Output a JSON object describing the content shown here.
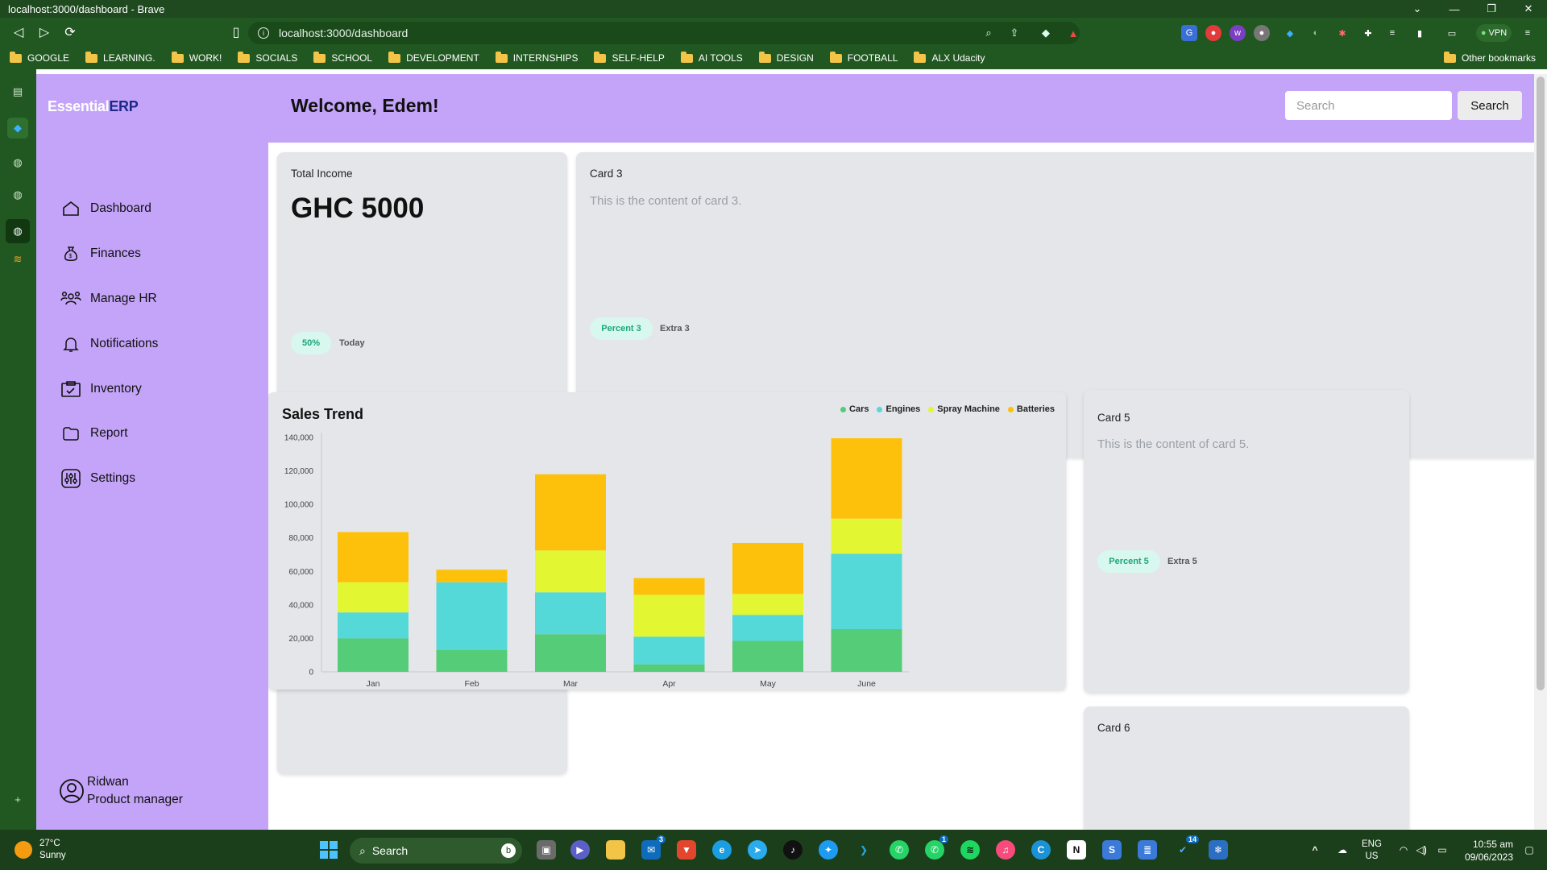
{
  "window": {
    "title": "localhost:3000/dashboard - Brave",
    "url": "localhost:3000/dashboard",
    "vpn_label": "VPN"
  },
  "bookmarks": [
    "GOOGLE",
    "LEARNING.",
    "WORK!",
    "SOCIALS",
    "SCHOOL",
    "DEVELOPMENT",
    "INTERNSHIPS",
    "SELF-HELP",
    "AI TOOLS",
    "DESIGN",
    "FOOTBALL",
    "ALX Udacity"
  ],
  "other_bookmarks": "Other bookmarks",
  "app": {
    "logo_part1": "Essential",
    "logo_part2": "ERP",
    "welcome": "Welcome, Edem!",
    "search_placeholder": "Search",
    "search_button": "Search",
    "nav": [
      "Dashboard",
      "Finances",
      "Manage HR",
      "Notifications",
      "Inventory",
      "Report",
      "Settings"
    ],
    "user": {
      "name": "Ridwan",
      "role": "Product manager"
    }
  },
  "cards": {
    "income": {
      "title": "Total Income",
      "value": "GHC 5000",
      "percent": "50%",
      "extra": "Today"
    },
    "card3": {
      "title": "Card 3",
      "content": "This is the content of card 3.",
      "percent": "Percent 3",
      "extra": "Extra 3"
    },
    "card5": {
      "title": "Card 5",
      "content": "This is the content of card 5.",
      "percent": "Percent 5",
      "extra": "Extra 5"
    },
    "card6": {
      "title": "Card 6"
    }
  },
  "chart_data": {
    "type": "bar",
    "stacked": true,
    "title": "Sales Trend",
    "categories": [
      "Jan",
      "Feb",
      "Mar",
      "Apr",
      "May",
      "June"
    ],
    "series": [
      {
        "name": "Cars",
        "color": "#55cc77",
        "values": [
          20000,
          13000,
          22500,
          4500,
          18500,
          25500
        ]
      },
      {
        "name": "Engines",
        "color": "#55d8d8",
        "values": [
          15500,
          40500,
          25000,
          16500,
          15500,
          45000
        ]
      },
      {
        "name": "Spray Machine",
        "color": "#e2f632",
        "values": [
          18000,
          0,
          25000,
          25000,
          12500,
          21000
        ]
      },
      {
        "name": "Batteries",
        "color": "#fdc10b",
        "values": [
          30000,
          7500,
          45500,
          10000,
          30500,
          48000
        ]
      }
    ],
    "yticks": [
      "0",
      "20,000",
      "40,000",
      "60,000",
      "80,000",
      "100,000",
      "120,000",
      "140,000"
    ],
    "ylim": [
      0,
      140000
    ],
    "legend": "top-right"
  },
  "taskbar": {
    "weather_temp": "27°C",
    "weather_desc": "Sunny",
    "search": "Search",
    "lang1": "ENG",
    "lang2": "US",
    "time": "10:55 am",
    "date": "09/06/2023",
    "badges": {
      "mail": "3",
      "whatsapp": "1",
      "vscode_tray": "14"
    }
  }
}
